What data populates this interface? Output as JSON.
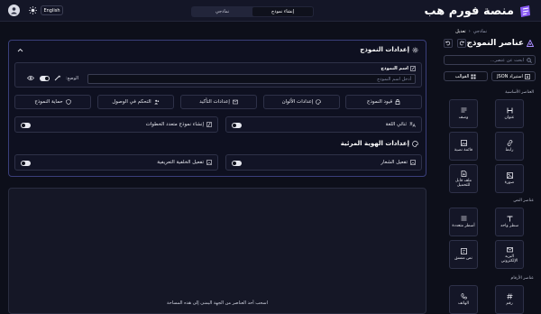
{
  "header": {
    "app_title": "منصة فورم هب",
    "tabs": [
      {
        "label": "نماذجي",
        "active": false
      },
      {
        "label": "إنشاء نموذج",
        "active": true
      }
    ],
    "language_label": "English"
  },
  "breadcrumb": {
    "items": [
      "نماذجي",
      "تعديل"
    ],
    "separator": "‹"
  },
  "sidebar": {
    "title": "عناصر النموذج",
    "search_placeholder": "ابحث عن عنصر...",
    "import_json_label": "استيراد JSON",
    "templates_label": "القوالب",
    "sections": {
      "basic": "العناصر الأساسية",
      "text": "عناصر النص",
      "numbers": "عناصر الأرقام"
    },
    "basic_items": [
      {
        "label": "عنوان",
        "icon": "heading-icon"
      },
      {
        "label": "وصف",
        "icon": "paragraph-icon"
      },
      {
        "label": "رابط",
        "icon": "link-icon"
      },
      {
        "label": "قائمة نصية",
        "icon": "image-list-icon"
      },
      {
        "label": "صورة",
        "icon": "image-icon"
      },
      {
        "label": "ملف قابل للتحميل",
        "icon": "download-file-icon"
      }
    ],
    "text_items": [
      {
        "label": "سطر واحد",
        "icon": "text-icon"
      },
      {
        "label": "أسطر متعددة",
        "icon": "multiline-icon"
      },
      {
        "label": "البريد الإلكتروني",
        "icon": "email-icon"
      },
      {
        "label": "نص منسق",
        "icon": "rich-text-icon"
      }
    ],
    "number_items": [
      {
        "label": "رقم",
        "icon": "number-icon"
      },
      {
        "label": "الهاتف",
        "icon": "phone-icon"
      }
    ]
  },
  "settings": {
    "title": "إعدادات النموذج",
    "name_label": "اسم النموذج",
    "name_placeholder": "أدخل اسم النموذج",
    "mode_label": "الوضع:",
    "buttons": [
      {
        "label": "قيود النموذج",
        "icon": "lock-icon"
      },
      {
        "label": "إعدادات الألوان",
        "icon": "palette-icon"
      },
      {
        "label": "إعدادات التأكيد",
        "icon": "mail-check-icon"
      },
      {
        "label": "التحكم في الوصول",
        "icon": "users-icon"
      },
      {
        "label": "حماية النموذج",
        "icon": "shield-icon"
      }
    ],
    "bilingual_label": "ثنائي اللغة",
    "multistep_label": "إنشاء نموذج متعدد الخطوات",
    "identity_title": "إعدادات الهوية المرئية",
    "enable_logo_label": "تفعيل الشعار",
    "enable_bg_label": "تفعيل الخلفية التعريفية"
  },
  "canvas": {
    "hint": "اسحب أحد العناصر من الجهة اليمنى إلى هذه المساحة"
  },
  "colors": {
    "accent": "#a78bfa",
    "panel_border": "#3a3f7a",
    "background": "#0d0f1a"
  }
}
